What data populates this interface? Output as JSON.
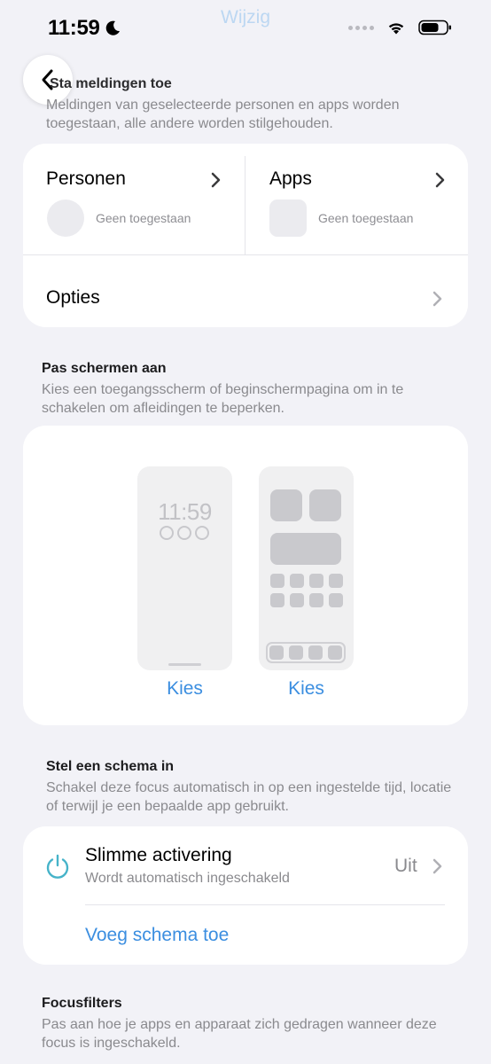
{
  "status": {
    "time": "11:59"
  },
  "header": {
    "edit_ghost": "Wijzig",
    "section_title": "Sta meldingen toe",
    "section_desc": "Meldingen van geselecteerde personen en apps worden toegestaan, alle andere worden stilgehouden."
  },
  "allow": {
    "people": {
      "title": "Personen",
      "status": "Geen toegestaan"
    },
    "apps": {
      "title": "Apps",
      "status": "Geen toegestaan"
    },
    "options": {
      "label": "Opties"
    }
  },
  "screens": {
    "title": "Pas schermen aan",
    "desc": "Kies een toegangsscherm of beginschermpagina om in te schakelen om afleidingen te beperken.",
    "lock_time": "11:59",
    "choose_lock": "Kies",
    "choose_home": "Kies"
  },
  "schedule": {
    "title": "Stel een schema in",
    "desc": "Schakel deze focus automatisch in op een ingestelde tijd, locatie of terwijl je een bepaalde app gebruikt.",
    "smart": {
      "title": "Slimme activering",
      "subtitle": "Wordt automatisch ingeschakeld",
      "value": "Uit"
    },
    "add_schedule": "Voeg schema toe"
  },
  "filters": {
    "title": "Focusfilters",
    "desc": "Pas aan hoe je apps en apparaat zich gedragen wanneer deze focus is ingeschakeld."
  },
  "colors": {
    "accent": "#3b8ee0",
    "power": "#46b3c9"
  }
}
